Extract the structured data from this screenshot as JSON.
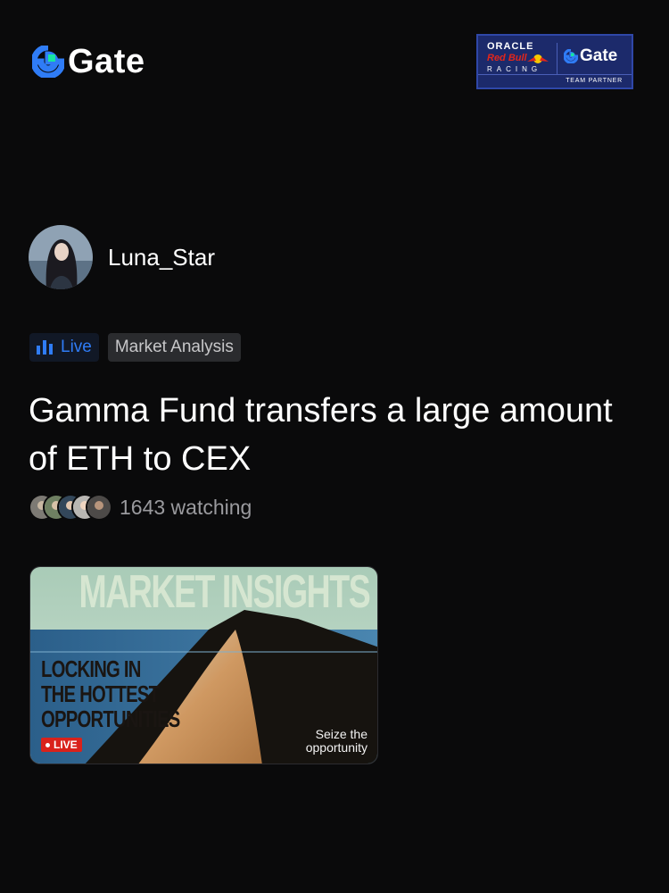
{
  "brand": {
    "name": "Gate",
    "accent": "#2f7cf6",
    "accent_green": "#17e5a1"
  },
  "partner": {
    "line1": "ORACLE",
    "line2": "Red Bull",
    "line3": "RACING",
    "gate": "Gate",
    "caption": "TEAM PARTNER"
  },
  "author": {
    "name": "Luna_Star"
  },
  "tags": {
    "live": "Live",
    "category": "Market Analysis"
  },
  "headline": "Gamma Fund transfers a large amount of ETH to CEX",
  "watchers": {
    "count_text": "1643 watching"
  },
  "card": {
    "title": "MARKET INSIGHTS",
    "tagline": [
      "LOCKING IN",
      "THE HOTTEST",
      "OPPORTUNITIES"
    ],
    "badge": "LIVE",
    "cta": [
      "Seize the",
      "opportunity"
    ]
  }
}
